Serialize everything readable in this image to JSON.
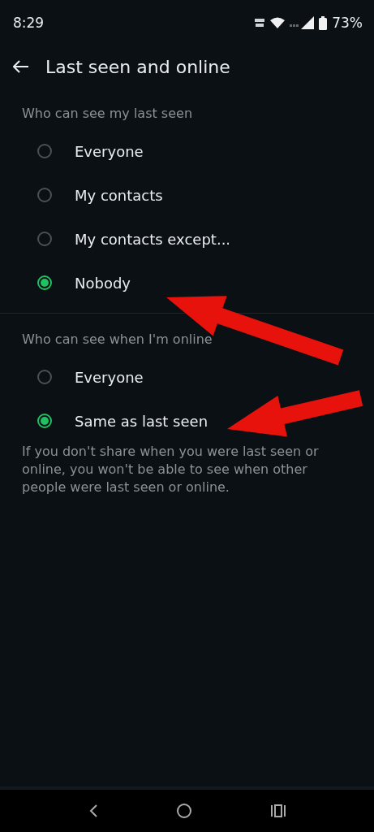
{
  "status_bar": {
    "time": "8:29",
    "battery": "73%"
  },
  "header": {
    "title": "Last seen and online"
  },
  "sections": [
    {
      "heading": "Who can see my last seen",
      "options": [
        {
          "label": "Everyone",
          "selected": false
        },
        {
          "label": "My contacts",
          "selected": false
        },
        {
          "label": "My contacts except...",
          "selected": false
        },
        {
          "label": "Nobody",
          "selected": true
        }
      ]
    },
    {
      "heading": "Who can see when I'm online",
      "options": [
        {
          "label": "Everyone",
          "selected": false
        },
        {
          "label": "Same as last seen",
          "selected": true
        }
      ]
    }
  ],
  "note": "If you don't share when you were last seen or online, you won't be able to see when other people were last seen or online."
}
